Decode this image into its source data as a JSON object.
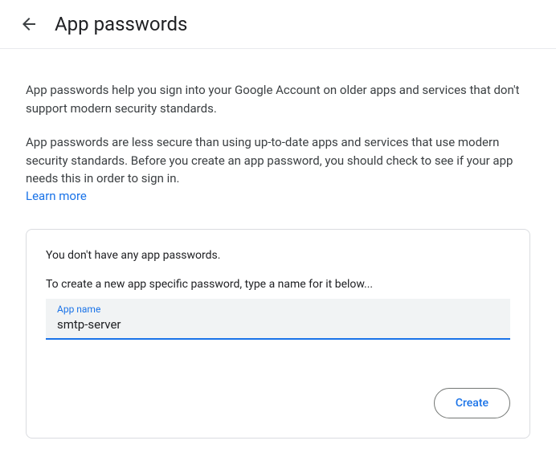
{
  "header": {
    "title": "App passwords"
  },
  "intro": {
    "para1": "App passwords help you sign into your Google Account on older apps and services that don't support modern security standards.",
    "para2": "App passwords are less secure than using up-to-date apps and services that use modern security standards. Before you create an app password, you should check to see if your app needs this in order to sign in.",
    "learn_more": "Learn more"
  },
  "card": {
    "no_passwords": "You don't have any app passwords.",
    "instruction": "To create a new app specific password, type a name for it below...",
    "input_label": "App name",
    "input_value": "smtp-server",
    "create_label": "Create"
  }
}
